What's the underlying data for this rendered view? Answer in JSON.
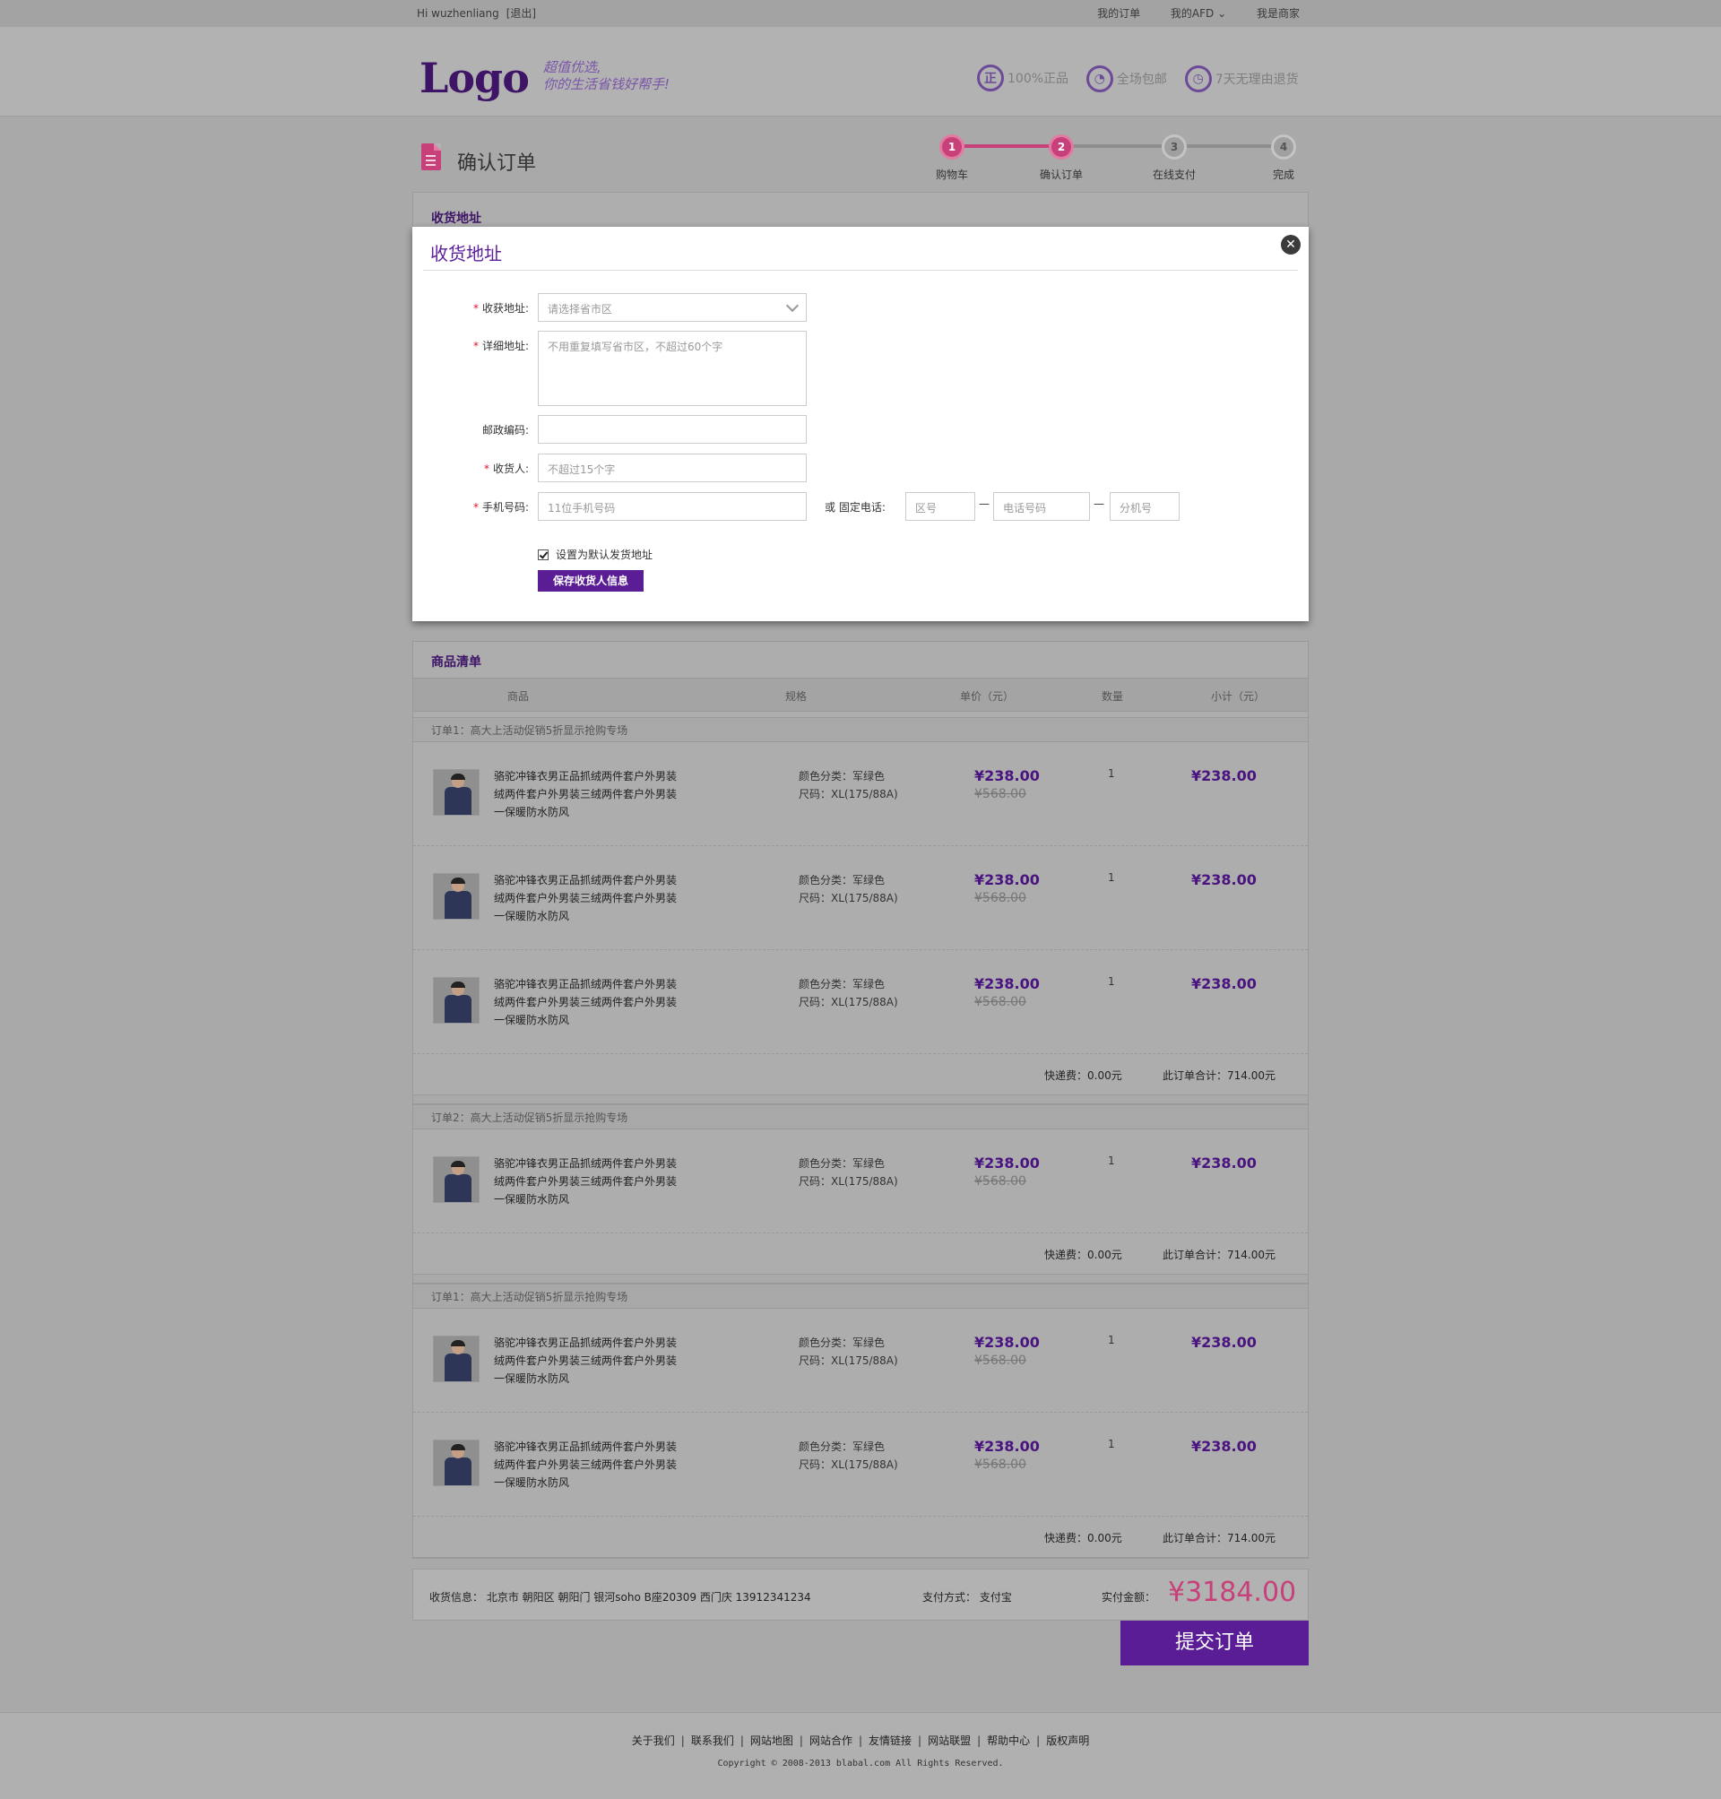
{
  "topbar": {
    "greeting": "Hi wuzhenliang",
    "logout": "[退出]",
    "links": [
      "我的订单",
      "我的AFD ⌄",
      "我是商家"
    ]
  },
  "header": {
    "logo": "Logo",
    "slogan_line1": "超值优选,",
    "slogan_line2": "你的生活省钱好帮手!",
    "promises": [
      {
        "icon": "genuine-icon",
        "glyph": "正",
        "label": "100%正品"
      },
      {
        "icon": "free-shipping-icon",
        "glyph": "◔",
        "label": "全场包邮"
      },
      {
        "icon": "return-clock-icon",
        "glyph": "◷",
        "label": "7天无理由退货"
      }
    ]
  },
  "page": {
    "title": "确认订单"
  },
  "steps": [
    {
      "num": "1",
      "label": "购物车"
    },
    {
      "num": "2",
      "label": "确认订单"
    },
    {
      "num": "3",
      "label": "在线支付"
    },
    {
      "num": "4",
      "label": "完成"
    }
  ],
  "address_panel": {
    "title": "收货地址"
  },
  "modal": {
    "title": "收货地址",
    "close": "✕",
    "fields": {
      "region": {
        "label": "收获地址:",
        "placeholder": "请选择省市区"
      },
      "detail": {
        "label": "详细地址:",
        "placeholder": "不用重复填写省市区，不超过60个字"
      },
      "zip": {
        "label": "邮政编码:",
        "placeholder": ""
      },
      "name": {
        "label": "收货人:",
        "placeholder": "不超过15个字"
      },
      "mobile": {
        "label": "手机号码:",
        "placeholder": "11位手机号码"
      },
      "or_phone": "或  固定电话:",
      "area": {
        "placeholder": "区号"
      },
      "phone": {
        "placeholder": "电话号码"
      },
      "ext": {
        "placeholder": "分机号"
      },
      "dash": "—"
    },
    "default_checkbox": "设置为默认发货地址",
    "save_button": "保存收货人信息"
  },
  "goods": {
    "title": "商品清单",
    "headers": [
      "商品",
      "规格",
      "单价（元）",
      "数量",
      "小计（元）"
    ],
    "product_name": "骆驼冲锋衣男正品抓绒两件套户外男装绒两件套户外男装三绒两件套户外男装一保暖防水防风",
    "spec_color": "颜色分类：军绿色",
    "spec_size": "尺码：XL(175/88A)",
    "price_now": "¥238.00",
    "price_old": "¥568.00",
    "qty": "1",
    "subtotal": "¥238.00",
    "shipping": "快递费：0.00元",
    "order_total": "此订单合计：714.00元",
    "orders": [
      {
        "name": "订单1：高大上活动促销5折显示抢购专场",
        "count": 3
      },
      {
        "name": "订单2：高大上活动促销5折显示抢购专场",
        "count": 1
      },
      {
        "name": "订单1：高大上活动促销5折显示抢购专场",
        "count": 2
      }
    ]
  },
  "summary": {
    "address": "收货信息：  北京市  朝阳区  朝阳门  银河soho B座20309      西门庆    13912341234",
    "payment": "支付方式：  支付宝",
    "amount_label": "实付金额：",
    "amount": "¥3184.00"
  },
  "submit_button": "提交订单",
  "footer": {
    "links": [
      "关于我们",
      "联系我们",
      "网站地图",
      "网站合作",
      "友情链接",
      "网站联盟",
      "帮助中心",
      "版权声明"
    ],
    "separator": "|",
    "copyright": "Copyright © 2008-2013 blabal.com All Rights Reserved."
  },
  "colors": {
    "brand_purple": "#5a1d96",
    "accent_pink": "#c8407a",
    "required_red": "#e2102c"
  }
}
